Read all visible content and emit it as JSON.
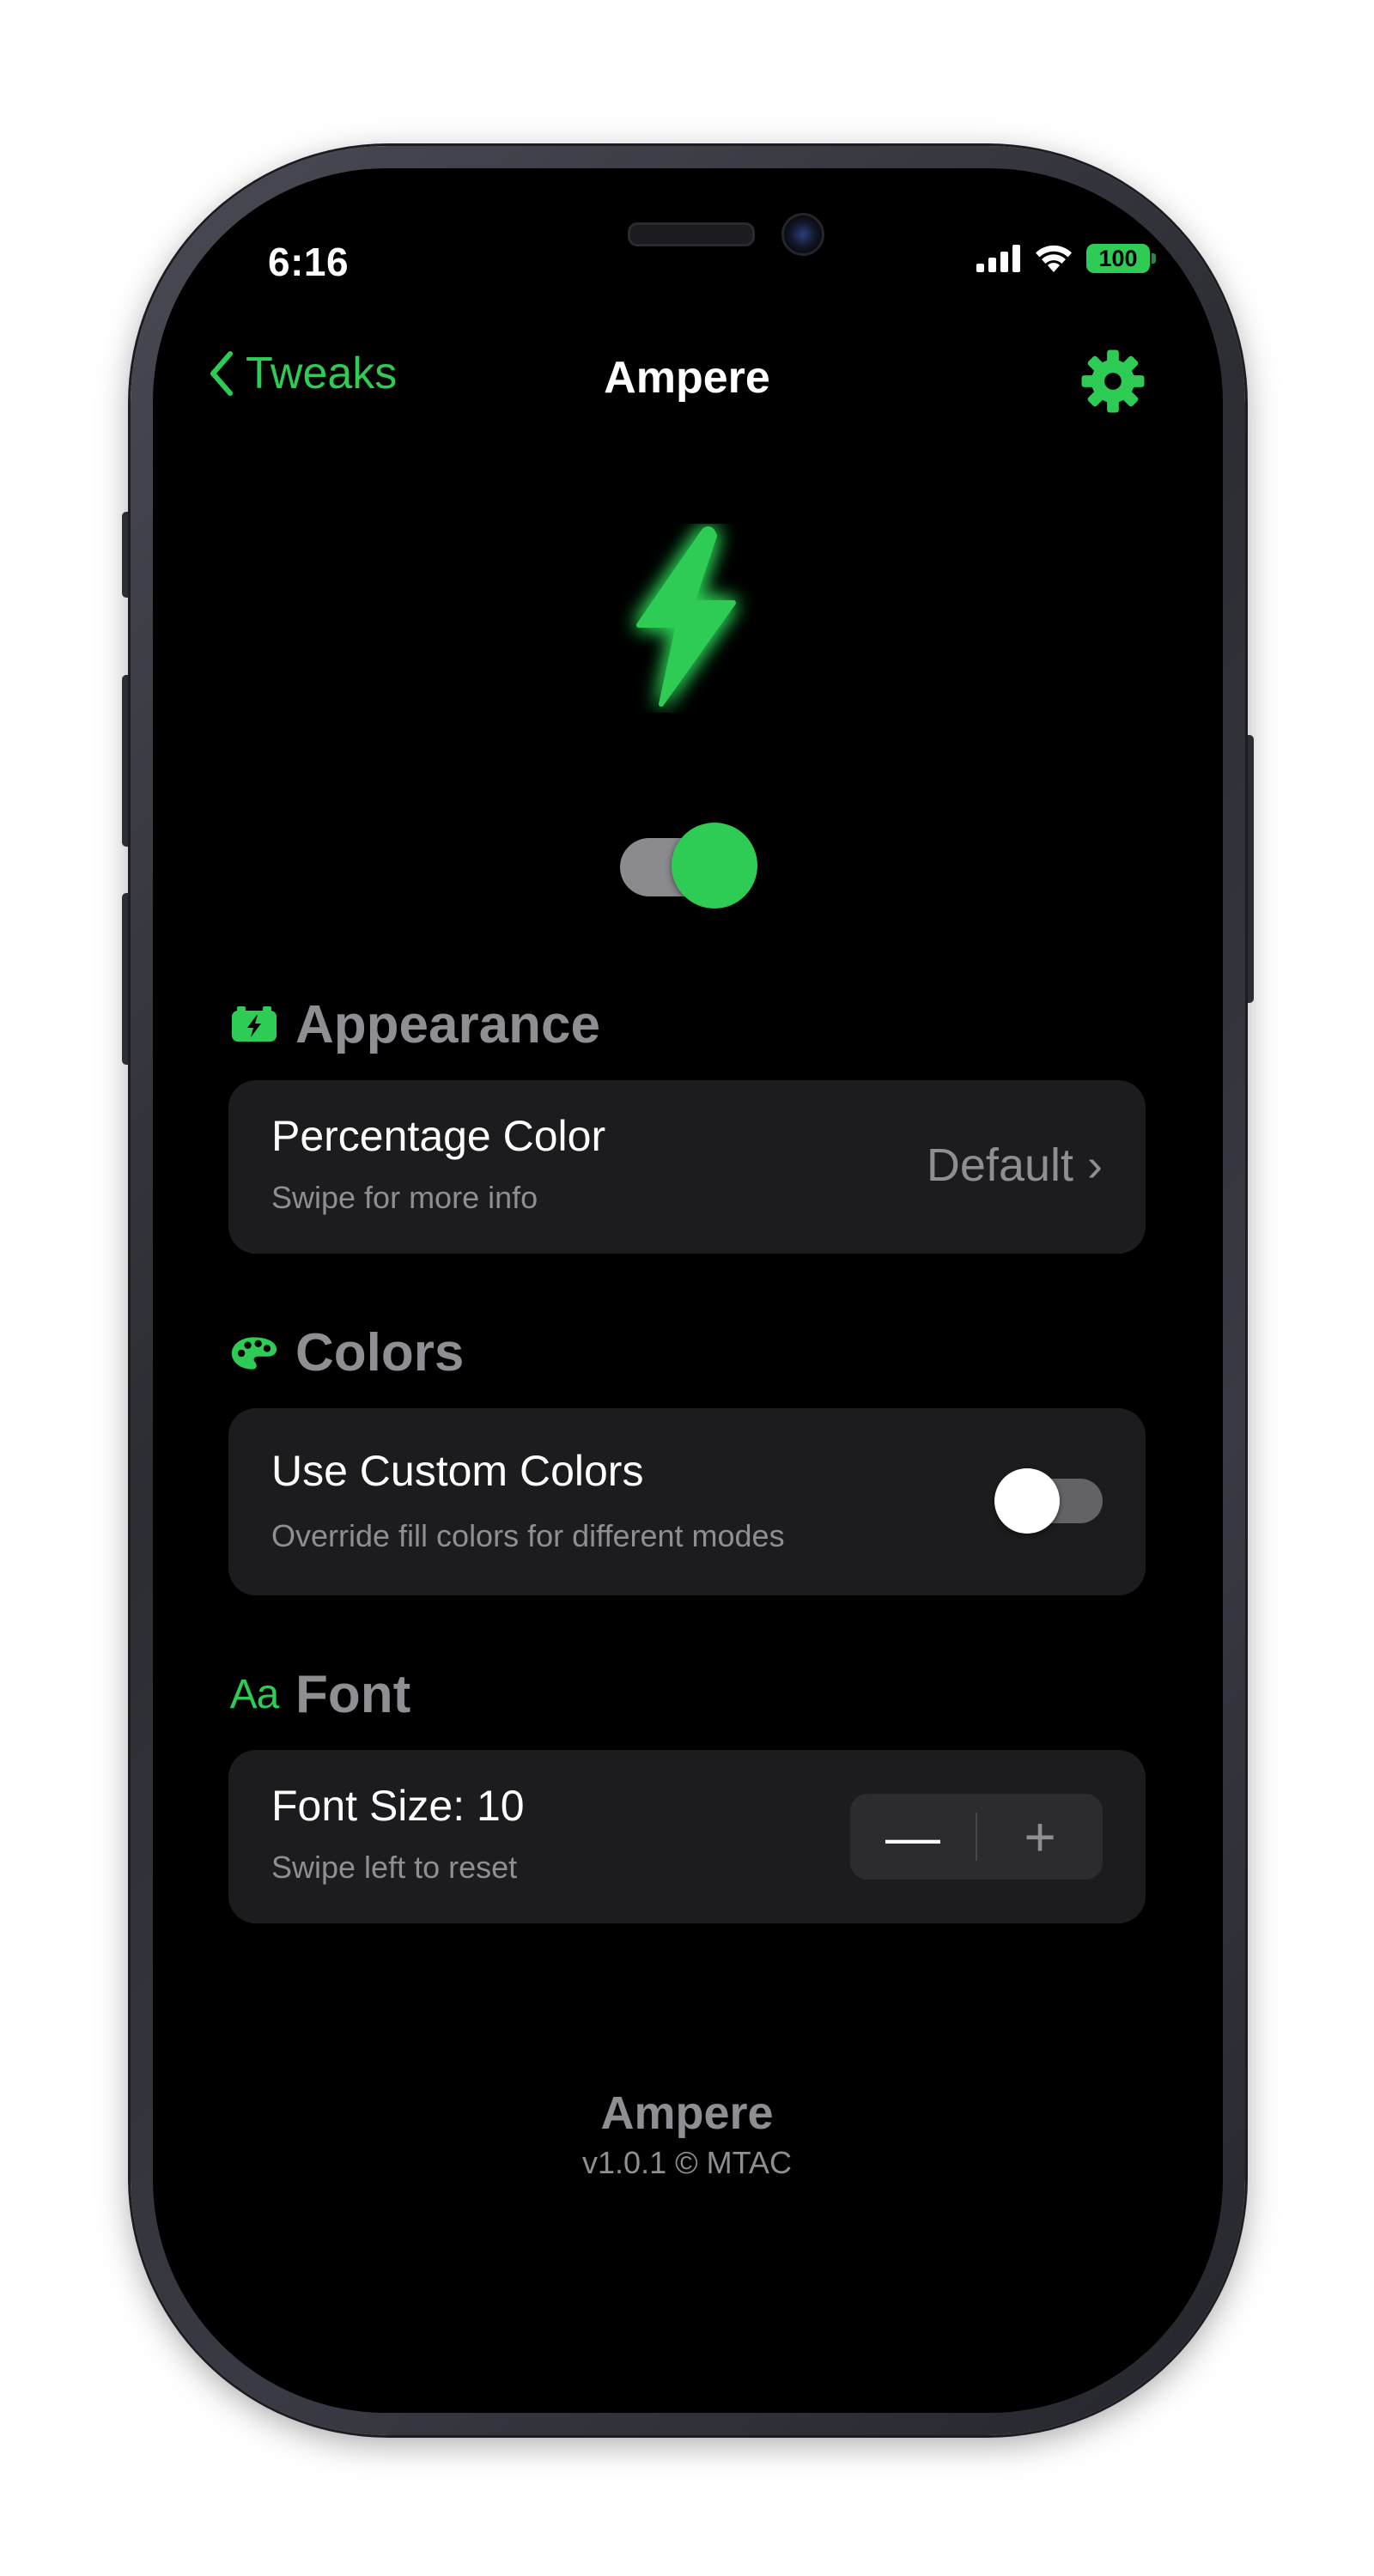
{
  "status_bar": {
    "time": "6:16",
    "battery": "100",
    "icons": [
      "cellular-signal-icon",
      "wifi-icon",
      "battery-icon"
    ]
  },
  "nav": {
    "back_label": "Tweaks",
    "title": "Ampere",
    "right_icon": "gear-icon"
  },
  "hero": {
    "icon": "lightning-bolt-icon",
    "enabled": true
  },
  "sections": {
    "appearance": {
      "header": "Appearance",
      "icon": "battery-bolt-icon",
      "row": {
        "title": "Percentage Color",
        "subtitle": "Swipe for more info",
        "value": "Default",
        "chevron": "›"
      }
    },
    "colors": {
      "header": "Colors",
      "icon": "palette-icon",
      "row": {
        "title": "Use Custom Colors",
        "subtitle": "Override fill colors for different modes",
        "enabled": false
      }
    },
    "font": {
      "header": "Font",
      "icon_text": "Aa",
      "row": {
        "title": "Font Size: 10",
        "subtitle": "Swipe left to reset",
        "decrement": "—",
        "increment": "+"
      }
    }
  },
  "footer": {
    "app_name": "Ampere",
    "version": "v1.0.1 © MTAC"
  },
  "colors": {
    "accent": "#2ecc55",
    "background": "#000000",
    "card": "#1c1c1e",
    "secondary_text": "#8e8e93"
  }
}
